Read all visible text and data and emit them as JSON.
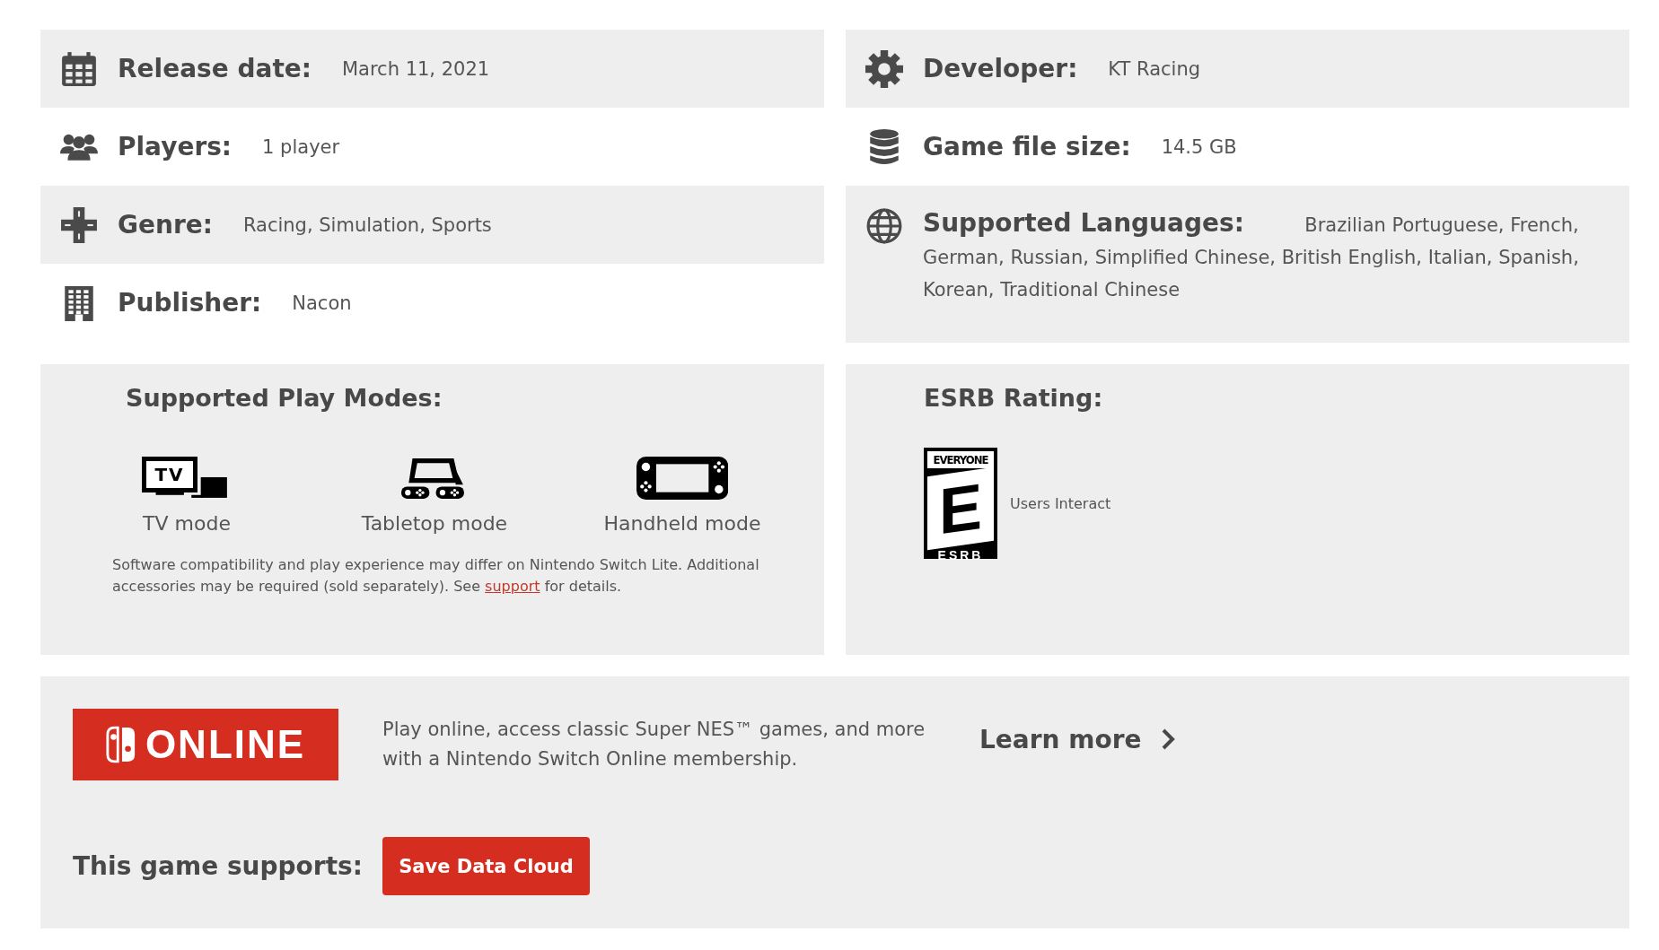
{
  "details_left": [
    {
      "label": "Release date:",
      "value": "March 11, 2021"
    },
    {
      "label": "Players:",
      "value": "1 player"
    },
    {
      "label": "Genre:",
      "value": "Racing, Simulation, Sports"
    },
    {
      "label": "Publisher:",
      "value": "Nacon"
    }
  ],
  "details_right": [
    {
      "label": "Developer:",
      "value": "KT Racing"
    },
    {
      "label": "Game file size:",
      "value": "14.5 GB"
    },
    {
      "label": "Supported Languages:",
      "value": "Brazilian Portuguese, French, German, Russian, Simplified Chinese, British English, Italian, Spanish, Korean, Traditional Chinese"
    }
  ],
  "play_modes": {
    "title": "Supported Play Modes:",
    "tv_icon_text": "TV",
    "modes": [
      {
        "label": "TV mode"
      },
      {
        "label": "Tabletop mode"
      },
      {
        "label": "Handheld mode"
      }
    ],
    "note_before": "Software compatibility and play experience may differ on Nintendo Switch Lite. Additional accessories may be required (sold separately). See",
    "note_link": "support",
    "note_after": "for details."
  },
  "esrb": {
    "title": "ESRB Rating:",
    "badge_top": "EVERYONE",
    "badge_letter": "E",
    "badge_bottom": "ESRB",
    "descriptor": "Users Interact"
  },
  "online": {
    "logo_text": "ONLINE",
    "text": "Play online, access classic Super NES™ games, and more with a Nintendo Switch Online membership.",
    "link": "Learn more",
    "supports_label": "This game supports:",
    "features": [
      "Save Data Cloud"
    ]
  }
}
